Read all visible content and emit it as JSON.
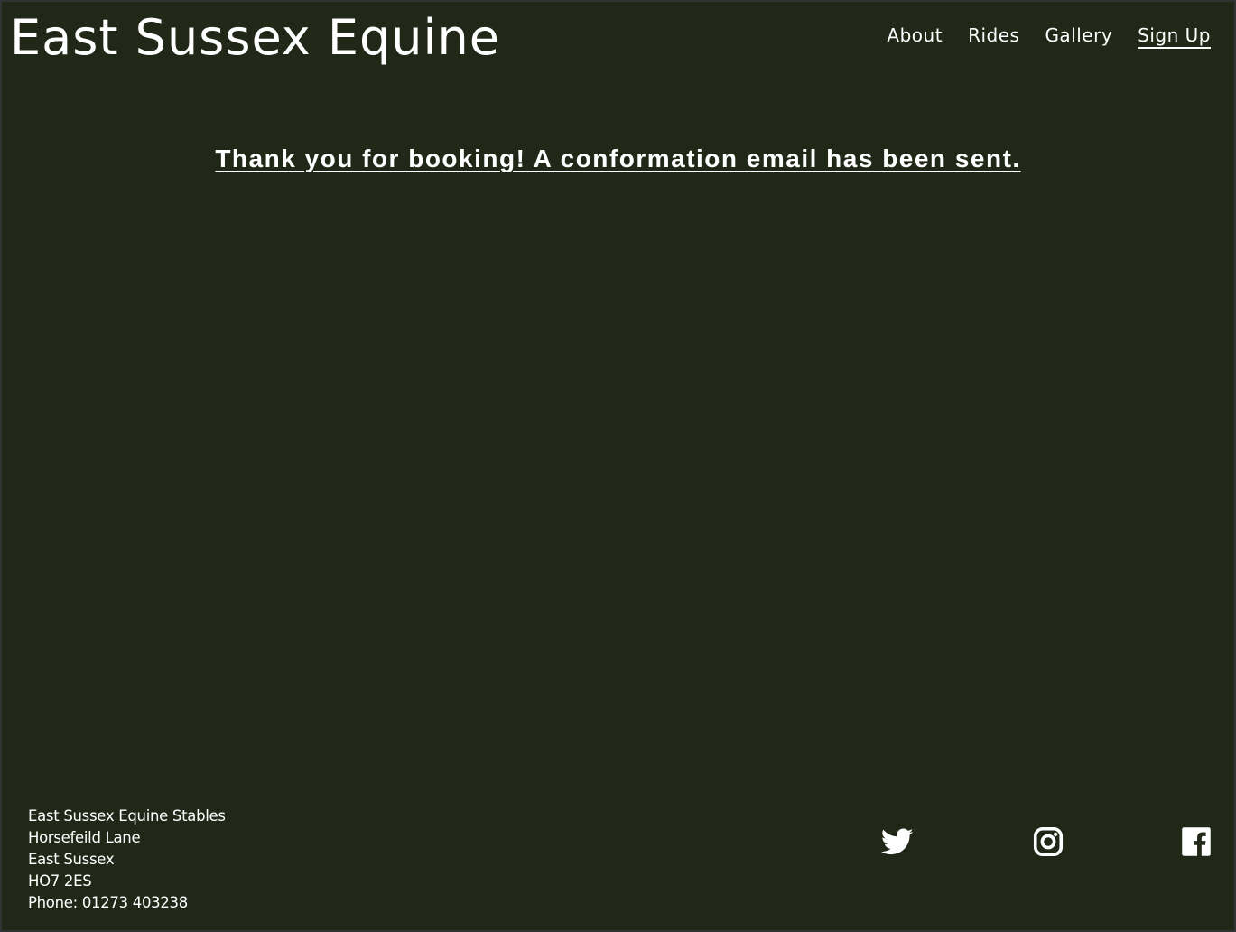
{
  "header": {
    "title": "East Sussex Equine",
    "nav": [
      {
        "label": "About"
      },
      {
        "label": "Rides"
      },
      {
        "label": "Gallery"
      },
      {
        "label": "Sign Up",
        "active": true
      }
    ]
  },
  "main": {
    "message": "Thank you for booking! A conformation email has been sent."
  },
  "footer": {
    "address": [
      "East Sussex Equine Stables",
      "Horsefeild Lane",
      "East Sussex",
      "HO7 2ES",
      "Phone: 01273 403238"
    ],
    "social_icons": [
      "twitter-icon",
      "instagram-icon",
      "facebook-icon"
    ]
  },
  "colors": {
    "background": "#212818",
    "outer_border": "#333333",
    "text": "#ffffff"
  }
}
